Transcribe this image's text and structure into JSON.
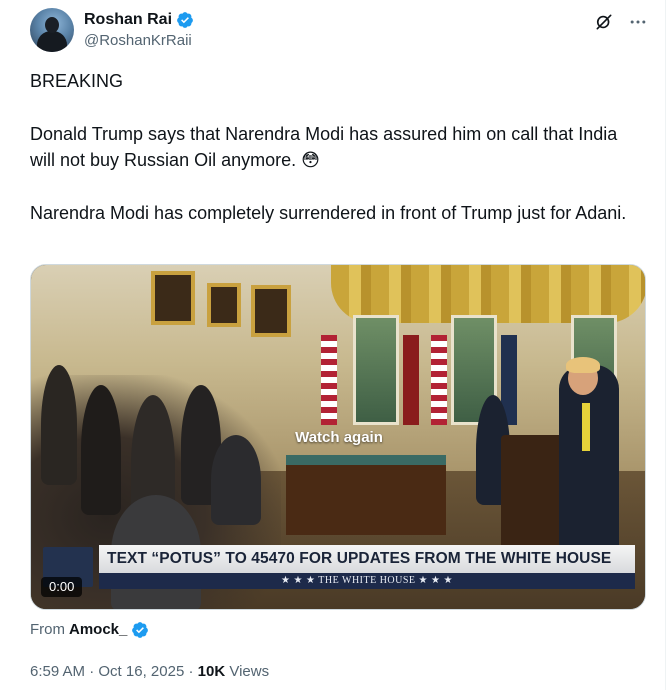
{
  "author": {
    "display_name": "Roshan Rai",
    "handle": "@RoshanKrRaii",
    "verified": true
  },
  "header_icons": [
    "grok-icon",
    "more-icon"
  ],
  "tweet": {
    "lines": [
      "BREAKING",
      "Donald Trump says that Narendra Modi has assured him on call that India will not buy Russian Oil anymore. 😳",
      "Narendra Modi has completely surrendered in front of Trump just for Adani."
    ]
  },
  "media": {
    "overlay_label": "Watch again",
    "duration": "0:00",
    "lower_third_main": "TEXT “POTUS” TO 45470 FOR UPDATES FROM THE WHITE HOUSE",
    "lower_third_sub": "★ ★ ★   THE WHITE HOUSE   ★ ★ ★"
  },
  "source": {
    "label": "From",
    "name": "Amock_",
    "verified": true
  },
  "meta": {
    "time": "6:59 AM",
    "separator": "·",
    "date": "Oct 16, 2025",
    "views_count": "10K",
    "views_label": "Views"
  },
  "colors": {
    "verified_blue": "#1d9bf0",
    "text_primary": "#0f1419",
    "text_secondary": "#536471"
  }
}
